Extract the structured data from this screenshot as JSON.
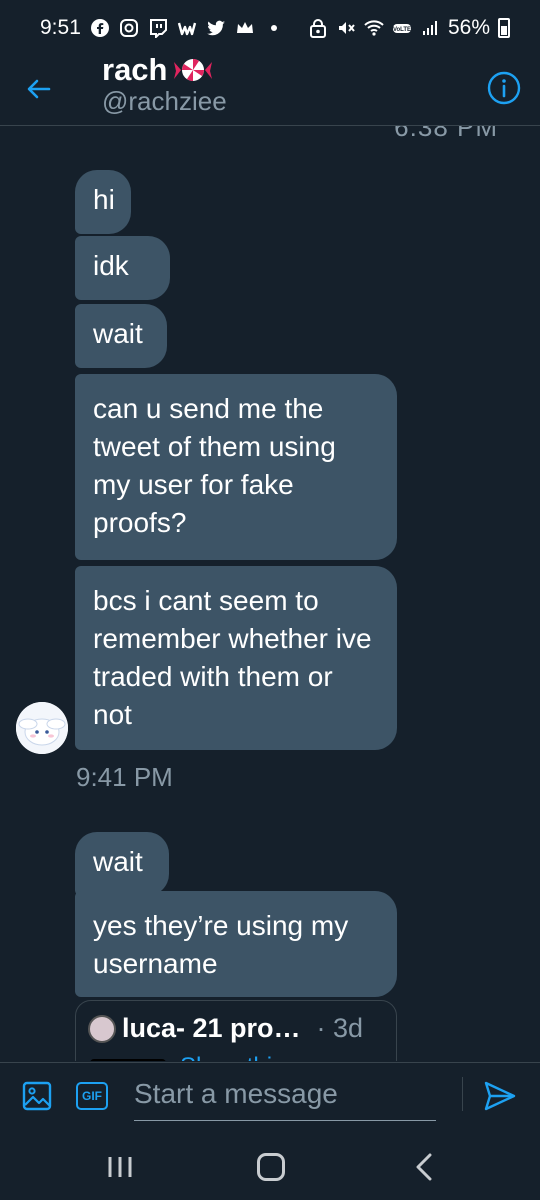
{
  "status_bar": {
    "time": "9:51",
    "battery": "56%",
    "icons": [
      "facebook-icon",
      "instagram-icon",
      "twitch-icon",
      "wattpad-icon",
      "twitter-icon",
      "crown-icon",
      "dot-icon",
      "lock-icon",
      "mute-icon",
      "wifi-icon",
      "volte-icon",
      "signal-icon",
      "battery-icon"
    ]
  },
  "header": {
    "title": "rach",
    "handle": "@rachziee",
    "title_icon": "candy-icon"
  },
  "chat": {
    "partial_timestamp": "6:38 PM",
    "messages": [
      {
        "text": "hi"
      },
      {
        "text": "idk"
      },
      {
        "text": "wait"
      },
      {
        "text": "can u send me the tweet of them using my user for fake proofs?"
      },
      {
        "text": "bcs i cant seem to remember whether ive traded with them or not"
      },
      {
        "text": "wait"
      },
      {
        "text": "yes they’re using my username"
      }
    ],
    "timestamp": "9:41 PM",
    "quoted_tweet": {
      "name": "luca- 21 pro…",
      "time": "· 3d",
      "link_partial": "Show thi"
    }
  },
  "composer": {
    "placeholder": "Start a message",
    "gif_label": "GIF"
  },
  "colors": {
    "background": "#15202b",
    "bubble": "#3d5466",
    "accent": "#1da1f2",
    "muted": "#8899a6"
  }
}
